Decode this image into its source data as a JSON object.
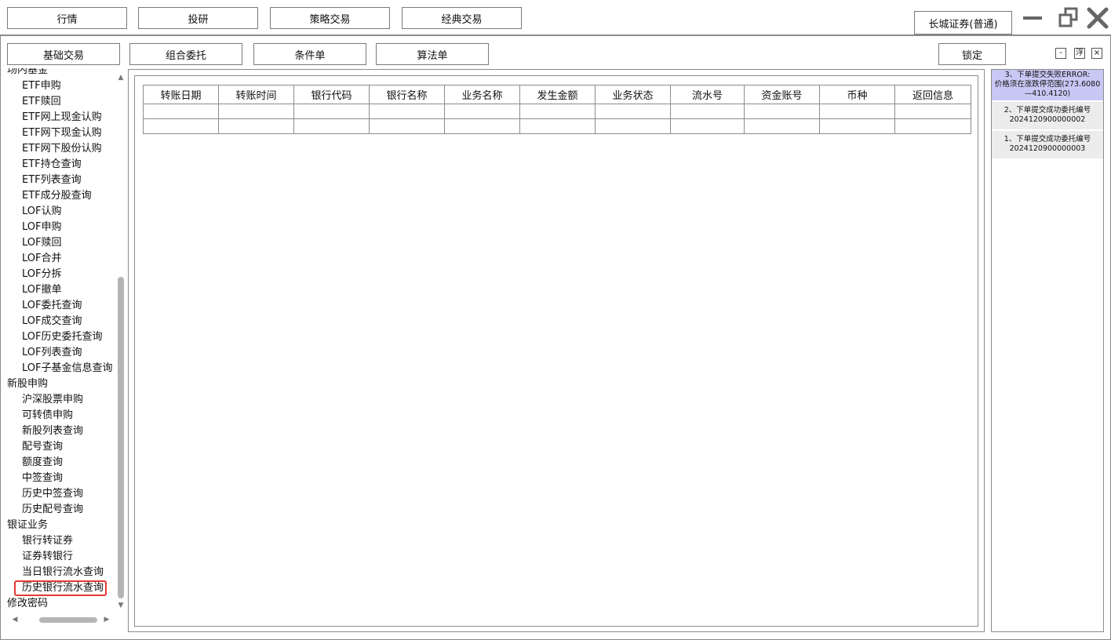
{
  "top_nav": {
    "buttons": [
      "行情",
      "投研",
      "策略交易",
      "经典交易"
    ],
    "broker_label": "长城证券(普通)",
    "window_controls": [
      "minimize-icon",
      "restore-icon",
      "close-icon"
    ]
  },
  "toolbar": {
    "tabs": [
      "基础交易",
      "组合委托",
      "条件单",
      "算法单"
    ],
    "lock_label": "锁定",
    "panel_controls": [
      "-",
      "浮",
      "×"
    ]
  },
  "sidebar": {
    "items": [
      {
        "label": "场内基金",
        "level": 0
      },
      {
        "label": "ETF申购",
        "level": 1
      },
      {
        "label": "ETF赎回",
        "level": 1
      },
      {
        "label": "ETF网上现金认购",
        "level": 1
      },
      {
        "label": "ETF网下现金认购",
        "level": 1
      },
      {
        "label": "ETF网下股份认购",
        "level": 1
      },
      {
        "label": "ETF持仓查询",
        "level": 1
      },
      {
        "label": "ETF列表查询",
        "level": 1
      },
      {
        "label": "ETF成分股查询",
        "level": 1
      },
      {
        "label": "LOF认购",
        "level": 1
      },
      {
        "label": "LOF申购",
        "level": 1
      },
      {
        "label": "LOF赎回",
        "level": 1
      },
      {
        "label": "LOF合并",
        "level": 1
      },
      {
        "label": "LOF分拆",
        "level": 1
      },
      {
        "label": "LOF撤单",
        "level": 1
      },
      {
        "label": "LOF委托查询",
        "level": 1
      },
      {
        "label": "LOF成交查询",
        "level": 1
      },
      {
        "label": "LOF历史委托查询",
        "level": 1
      },
      {
        "label": "LOF列表查询",
        "level": 1
      },
      {
        "label": "LOF子基金信息查询",
        "level": 1
      },
      {
        "label": "新股申购",
        "level": 0
      },
      {
        "label": "沪深股票申购",
        "level": 1
      },
      {
        "label": "可转债申购",
        "level": 1
      },
      {
        "label": "新股列表查询",
        "level": 1
      },
      {
        "label": "配号查询",
        "level": 1
      },
      {
        "label": "额度查询",
        "level": 1
      },
      {
        "label": "中签查询",
        "level": 1
      },
      {
        "label": "历史中签查询",
        "level": 1
      },
      {
        "label": "历史配号查询",
        "level": 1
      },
      {
        "label": "银证业务",
        "level": 0
      },
      {
        "label": "银行转证券",
        "level": 1
      },
      {
        "label": "证券转银行",
        "level": 1
      },
      {
        "label": "当日银行流水查询",
        "level": 1
      },
      {
        "label": "历史银行流水查询",
        "level": 1,
        "selected": true
      },
      {
        "label": "修改密码",
        "level": 0
      }
    ]
  },
  "table": {
    "columns": [
      "转账日期",
      "转账时间",
      "银行代码",
      "银行名称",
      "业务名称",
      "发生金额",
      "业务状态",
      "流水号",
      "资金账号",
      "币种",
      "返回信息"
    ],
    "rows": [
      [
        "",
        "",
        "",
        "",
        "",
        "",
        "",
        "",
        "",
        "",
        ""
      ],
      [
        "",
        "",
        "",
        "",
        "",
        "",
        "",
        "",
        "",
        "",
        ""
      ]
    ]
  },
  "messages": [
    {
      "type": "error",
      "lines": [
        "3、下单提交失败ERROR:",
        "价格须在涨跌停范围(273.6080",
        "—410.4120)"
      ]
    },
    {
      "type": "ok",
      "lines": [
        "2、下单提交成功委托编号",
        "2024120900000002"
      ]
    },
    {
      "type": "ok",
      "lines": [
        "1、下单提交成功委托编号",
        "2024120900000003"
      ]
    }
  ]
}
